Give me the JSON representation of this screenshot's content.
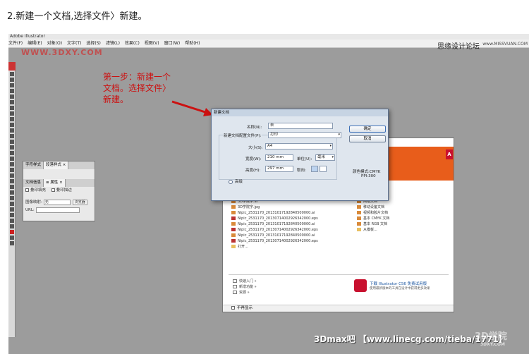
{
  "heading": "2.新建一个文档,选择文件〉新建。",
  "app": {
    "window_title": "Adobe Illustrator",
    "menu": [
      "文件(F)",
      "编辑(E)",
      "对象(O)",
      "文字(T)",
      "选择(S)",
      "滤镜(L)",
      "效果(C)",
      "视图(V)",
      "窗口(W)",
      "帮助(H)"
    ],
    "forum_label": "思缘设计论坛",
    "forum_url": "www.MISSVUAN.COM",
    "watermark": "WWW.3DXY.COM"
  },
  "annotation": "第一步：新建一个文档。选择文件〉新建。",
  "panel": {
    "tabs_top": [
      "字符样式",
      "段落样式 ×"
    ],
    "tabs_bottom": [
      "文档信息",
      "≡ 属性 ×"
    ],
    "overprint_fill": "叠印填充",
    "overprint_stroke": "叠印描边",
    "image_map_label": "图像映射:",
    "image_map_value": "无",
    "browser_button": "浏览器",
    "url_label": "URL:"
  },
  "dialog": {
    "title": "新建文档",
    "name_label": "名称(N):",
    "name_value": "未",
    "profile_label": "新建文档配置文件(P):",
    "profile_value": "打印",
    "size_label": "大小(S):",
    "size_value": "A4",
    "width_label": "宽度(W):",
    "width_value": "210 mm",
    "units_label": "单位(U):",
    "units_value": "毫米",
    "height_label": "高度(H):",
    "height_value": "297 mm",
    "orientation_label": "取向:",
    "advanced_label": "高级",
    "ok_button": "确定",
    "cancel_button": "取消",
    "color_mode": "颜色模式:CMYK",
    "ppi": "PPI:300"
  },
  "welcome": {
    "recent_files": [
      "3D学院字.ai",
      "3D学院字.jpg",
      "Nipic_2531170_20131017192840500000.ai",
      "Nipic_2531170_20130714002926342000.eps",
      "Nipic_2531170_20131017192840500000.ai",
      "Nipic_2531170_20130714002926342000.eps",
      "Nipic_2531170_20131017192840500000.ai",
      "Nipic_2531170_20130714002926342000.eps",
      "打开..."
    ],
    "new_from": [
      "网站文档",
      "移动设备文档",
      "视频和胶片文档",
      "基本 CMYK 文档",
      "基本 RGB 文档",
      "从模板..."
    ],
    "links": [
      "快速入门 »",
      "新增功能 »",
      "资源 »"
    ],
    "promo_title": "下载 Illustrator CS6 免费试用版",
    "promo_sub": "使用最新版本的工具在设计中获得更多效果",
    "dont_show": "不再显示"
  },
  "bottom_watermark": "3Dmax吧 【www.linecg.com/tieba/1771】",
  "corner_watermark": "3D学院",
  "corner_watermark_sub": "3DXY.COM",
  "colors": {
    "annotation": "#cc1111",
    "adobe_orange": "#e85d1b",
    "workspace": "#9c9c9c"
  }
}
